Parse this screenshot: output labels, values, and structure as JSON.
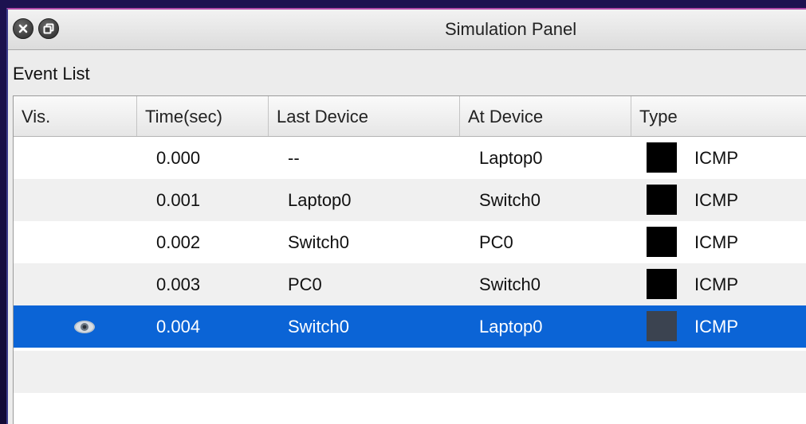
{
  "window": {
    "title": "Simulation Panel",
    "close_icon": "close-icon",
    "restore_icon": "restore-icon"
  },
  "event_list": {
    "label": "Event List",
    "columns": {
      "vis": "Vis.",
      "time": "Time(sec)",
      "last_device": "Last Device",
      "at_device": "At Device",
      "type": "Type"
    },
    "rows": [
      {
        "visible": false,
        "time": "0.000",
        "last_device": "--",
        "at_device": "Laptop0",
        "color": "#000000",
        "type": "ICMP",
        "selected": false
      },
      {
        "visible": false,
        "time": "0.001",
        "last_device": "Laptop0",
        "at_device": "Switch0",
        "color": "#000000",
        "type": "ICMP",
        "selected": false
      },
      {
        "visible": false,
        "time": "0.002",
        "last_device": "Switch0",
        "at_device": "PC0",
        "color": "#000000",
        "type": "ICMP",
        "selected": false
      },
      {
        "visible": false,
        "time": "0.003",
        "last_device": "PC0",
        "at_device": "Switch0",
        "color": "#000000",
        "type": "ICMP",
        "selected": false
      },
      {
        "visible": true,
        "vis_icon": "eye-icon",
        "time": "0.004",
        "last_device": "Switch0",
        "at_device": "Laptop0",
        "color": "#3b4350",
        "type": "ICMP",
        "selected": true
      }
    ]
  },
  "colors": {
    "selection": "#0b64d6",
    "row_alt": "#f0f0f0"
  }
}
